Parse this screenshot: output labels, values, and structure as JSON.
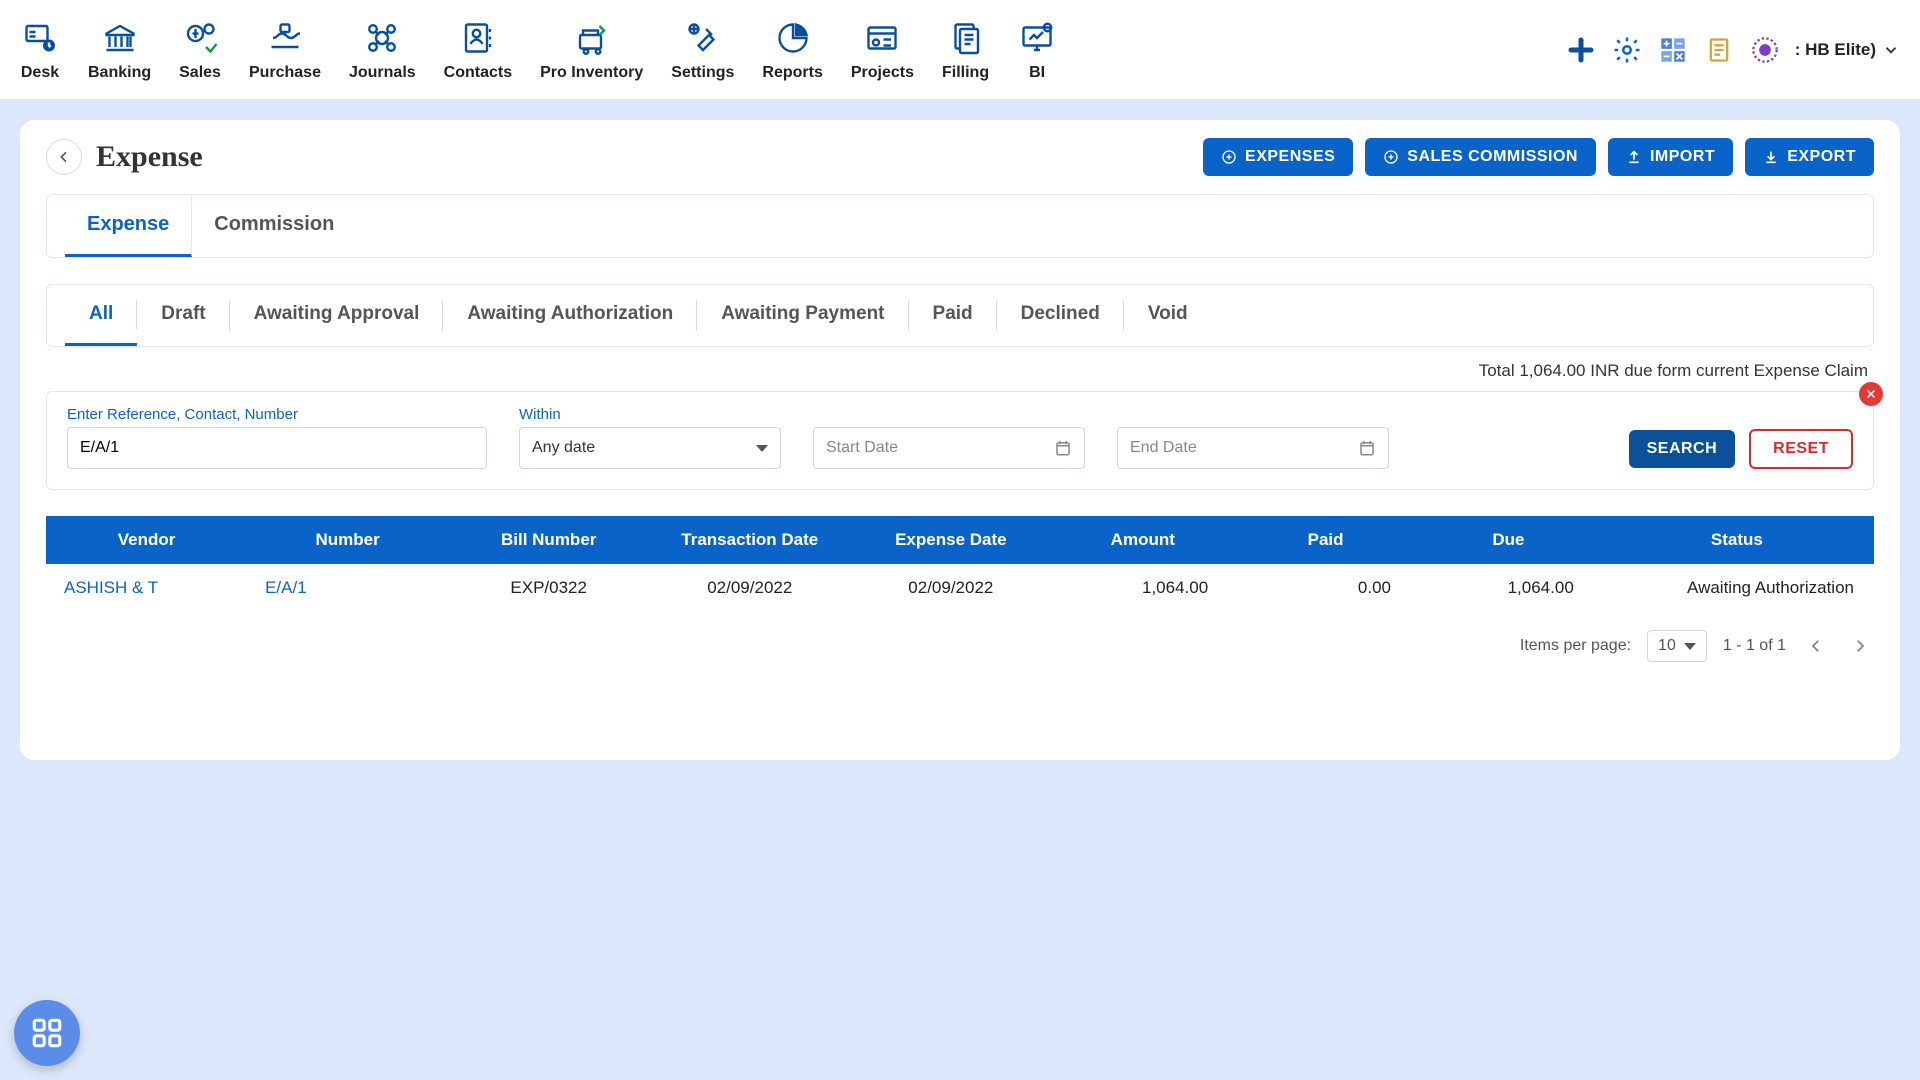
{
  "nav": [
    {
      "label": "Desk"
    },
    {
      "label": "Banking"
    },
    {
      "label": "Sales"
    },
    {
      "label": "Purchase"
    },
    {
      "label": "Journals"
    },
    {
      "label": "Contacts"
    },
    {
      "label": "Pro Inventory"
    },
    {
      "label": "Settings"
    },
    {
      "label": "Reports"
    },
    {
      "label": "Projects"
    },
    {
      "label": "Filling"
    },
    {
      "label": "BI"
    }
  ],
  "org_label": ": HB Elite)",
  "page": {
    "title": "Expense"
  },
  "actions": {
    "expenses": "EXPENSES",
    "sales_commission": "SALES COMMISSION",
    "import": "IMPORT",
    "export": "EXPORT"
  },
  "tabs": {
    "expense": "Expense",
    "commission": "Commission"
  },
  "status_tabs": [
    "All",
    "Draft",
    "Awaiting Approval",
    "Awaiting Authorization",
    "Awaiting Payment",
    "Paid",
    "Declined",
    "Void"
  ],
  "summary": "Total 1,064.00 INR due form current Expense Claim",
  "filter": {
    "ref_label": "Enter Reference, Contact, Number",
    "ref_value": "E/A/1",
    "within_label": "Within",
    "within_value": "Any date",
    "start_ph": "Start Date",
    "end_ph": "End Date",
    "search": "SEARCH",
    "reset": "RESET"
  },
  "columns": [
    "Vendor",
    "Number",
    "Bill Number",
    "Transaction Date",
    "Expense Date",
    "Amount",
    "Paid",
    "Due",
    "Status"
  ],
  "rows": [
    {
      "vendor": "ASHISH & T",
      "number": "E/A/1",
      "bill": "EXP/0322",
      "tdate": "02/09/2022",
      "edate": "02/09/2022",
      "amount": "1,064.00",
      "paid": "0.00",
      "due": "1,064.00",
      "status": "Awaiting Authorization"
    }
  ],
  "pager": {
    "items_label": "Items per page:",
    "size": "10",
    "range": "1 - 1 of 1"
  }
}
